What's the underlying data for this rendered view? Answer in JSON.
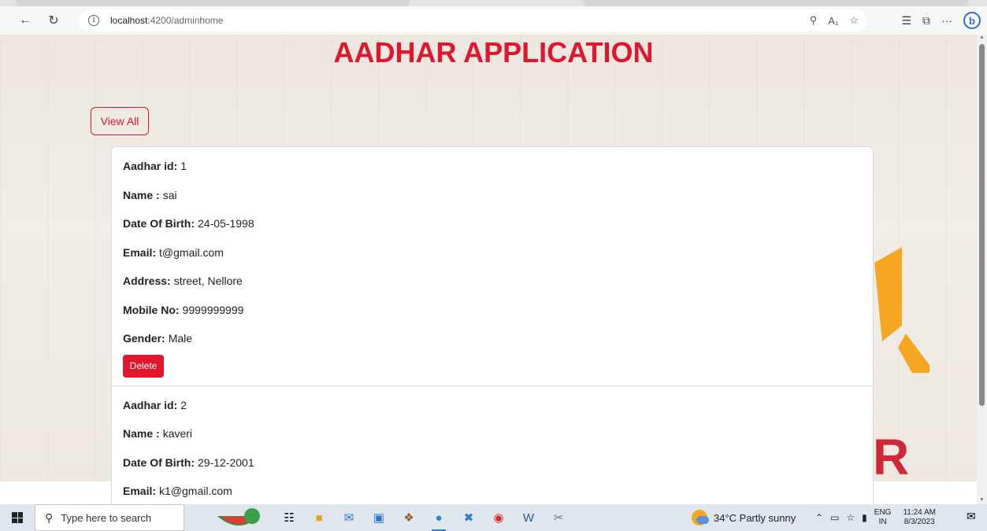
{
  "browser": {
    "url_host": "localhost",
    "url_path": ":4200/adminhome",
    "back_icon": "arrow-left-icon",
    "refresh_icon": "refresh-icon"
  },
  "page": {
    "title": "AADHAR APPLICATION",
    "view_all_label": "View All",
    "delete_label": "Delete",
    "labels": {
      "aadhar_id": "Aadhar id:",
      "name": "Name :",
      "dob": "Date Of Birth:",
      "email": "Email:",
      "address": "Address:",
      "mobile": "Mobile No:",
      "gender": "Gender:"
    },
    "records": [
      {
        "aadhar_id": "1",
        "name": "sai",
        "dob": "24-05-1998",
        "email": "t@gmail.com",
        "address": "street, Nellore",
        "mobile": "9999999999",
        "gender": "Male"
      },
      {
        "aadhar_id": "2",
        "name": "kaveri",
        "dob": "29-12-2001",
        "email": "k1@gmail.com"
      }
    ],
    "logo_letter": "R"
  },
  "taskbar": {
    "search_placeholder": "Type here to search",
    "weather": "34°C  Partly sunny",
    "lang_top": "ENG",
    "lang_bottom": "IN",
    "time": "11:24 AM",
    "date": "8/3/2023"
  },
  "colors": {
    "accent_red": "#e3152d",
    "logo_orange": "#f5a623",
    "logo_red": "#d0283a"
  }
}
